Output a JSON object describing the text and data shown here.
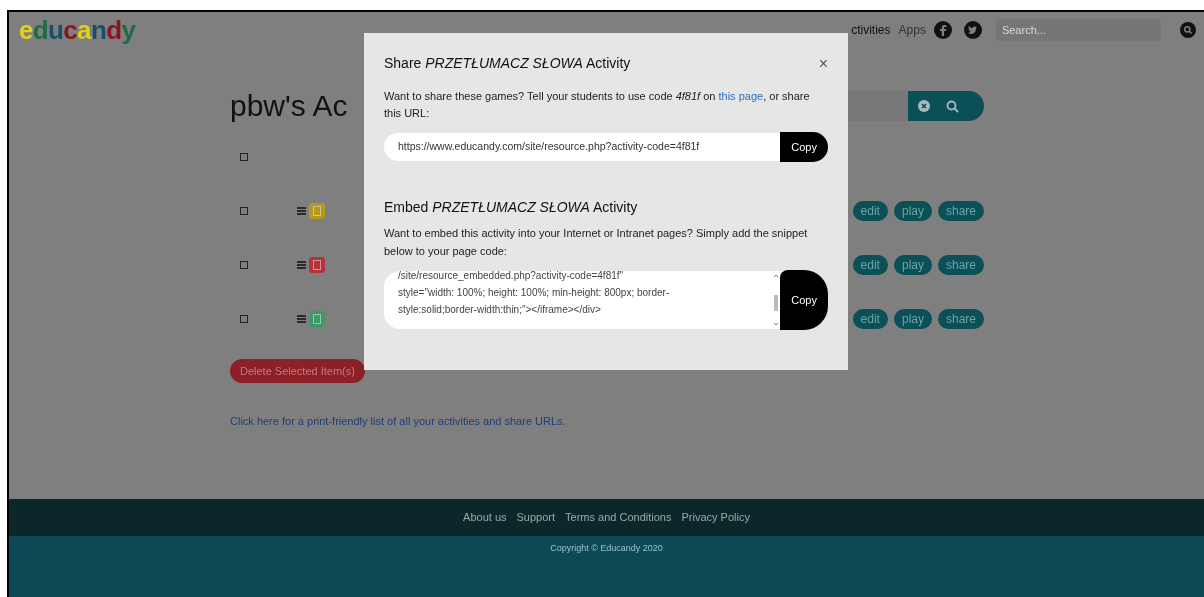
{
  "header": {
    "logo": "educandy",
    "nav": [
      {
        "label": "ctivities"
      },
      {
        "label": "Apps"
      }
    ],
    "search": {
      "placeholder": "Search..."
    }
  },
  "page": {
    "title": "pbw's Ac",
    "rows": [
      {
        "checked": false,
        "buttons": []
      },
      {
        "checked": false,
        "color": "#b39a1e",
        "buttons": [
          "edit",
          "play",
          "share"
        ]
      },
      {
        "checked": false,
        "color": "#b8323a",
        "buttons": [
          "edit",
          "play",
          "share"
        ]
      },
      {
        "checked": false,
        "color": "#3f9a6a",
        "buttons": [
          "edit",
          "play",
          "share"
        ]
      }
    ],
    "delete_button": "Delete Selected Item(s)",
    "print_link": "Click here for a print-friendly list of all your activities and share URLs."
  },
  "modal": {
    "title": "Share *PRZETŁUMACZ SŁOWA* Activity",
    "close": "×",
    "share_text": "Want to share these games? Tell your students to use code *4f81f* on",
    "share_link": "this page",
    "share_text_end": ", or share this URL:",
    "url": "https://www.educandy.com/site/resource.php?activity-code=4f81f",
    "copy_url": "Copy",
    "embed_title": "Embed *PRZETŁUMACZ SŁOWA* Activity",
    "embed_text": "Want to embed this activity into your Internet or Intranet pages? Simply add the snippet below to your page code:",
    "embed_code": "/site/resource_embedded.php?activity-code=4f81f\"\nstyle=\"width: 100%; height: 100%; min-height: 800px; border-\nstyle:solid;border-width:thin;\"></iframe></div>",
    "copy_embed": "Copy"
  },
  "footer": {
    "links": [
      "About us",
      "Support",
      "Terms and Conditions",
      "Privacy Policy"
    ],
    "copyright": "Copyright © Educandy 2020"
  }
}
